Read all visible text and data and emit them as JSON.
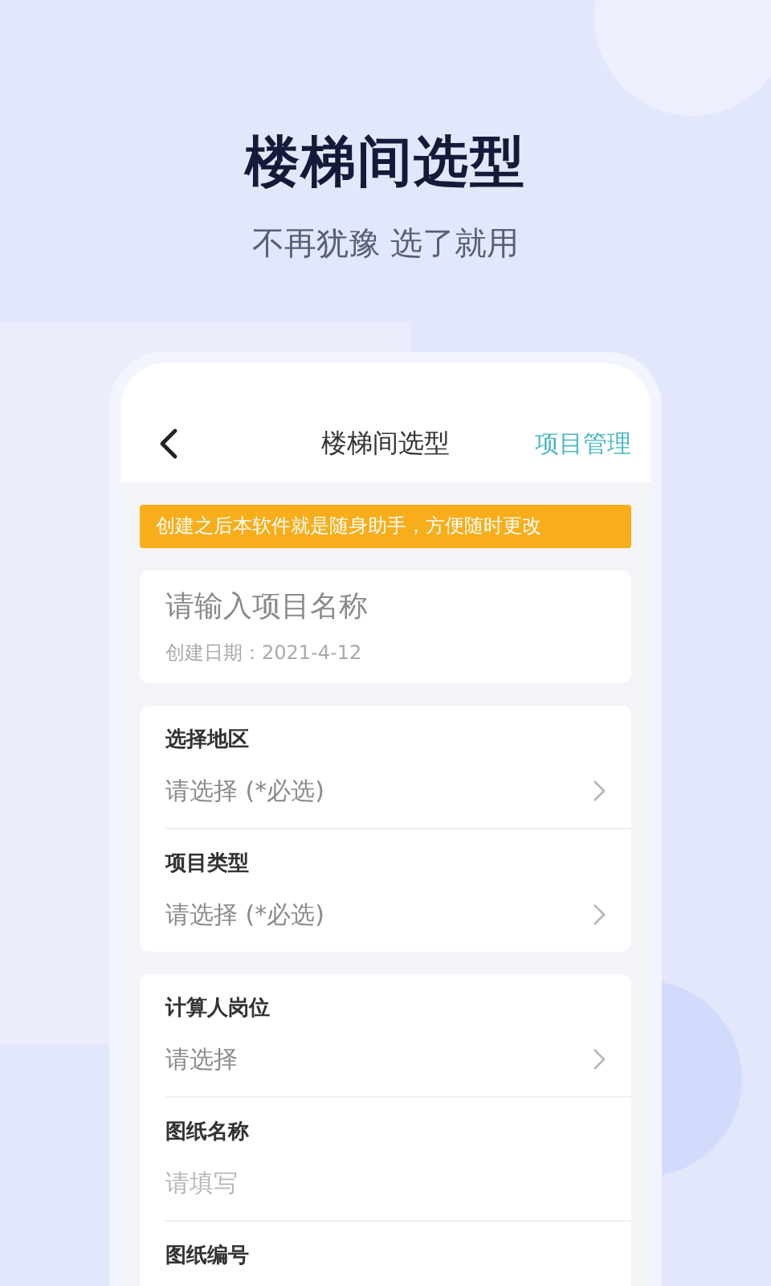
{
  "headline": "楼梯间选型",
  "subtitle": "不再犹豫 选了就用",
  "app": {
    "title": "楼梯间选型",
    "action": "项目管理",
    "notice": "创建之后本软件就是随身助手，方便随时更改",
    "project": {
      "placeholder": "请输入项目名称",
      "date": "创建日期：2021-4-12"
    },
    "groups": [
      {
        "fields": [
          {
            "label": "选择地区",
            "kind": "select",
            "placeholder": "请选择 (*必选)"
          },
          {
            "label": "项目类型",
            "kind": "select",
            "placeholder": "请选择 (*必选)"
          }
        ]
      },
      {
        "fields": [
          {
            "label": "计算人岗位",
            "kind": "select",
            "placeholder": "请选择"
          },
          {
            "label": "图纸名称",
            "kind": "input",
            "placeholder": "请填写"
          },
          {
            "label": "图纸编号",
            "kind": "label"
          }
        ]
      }
    ]
  }
}
